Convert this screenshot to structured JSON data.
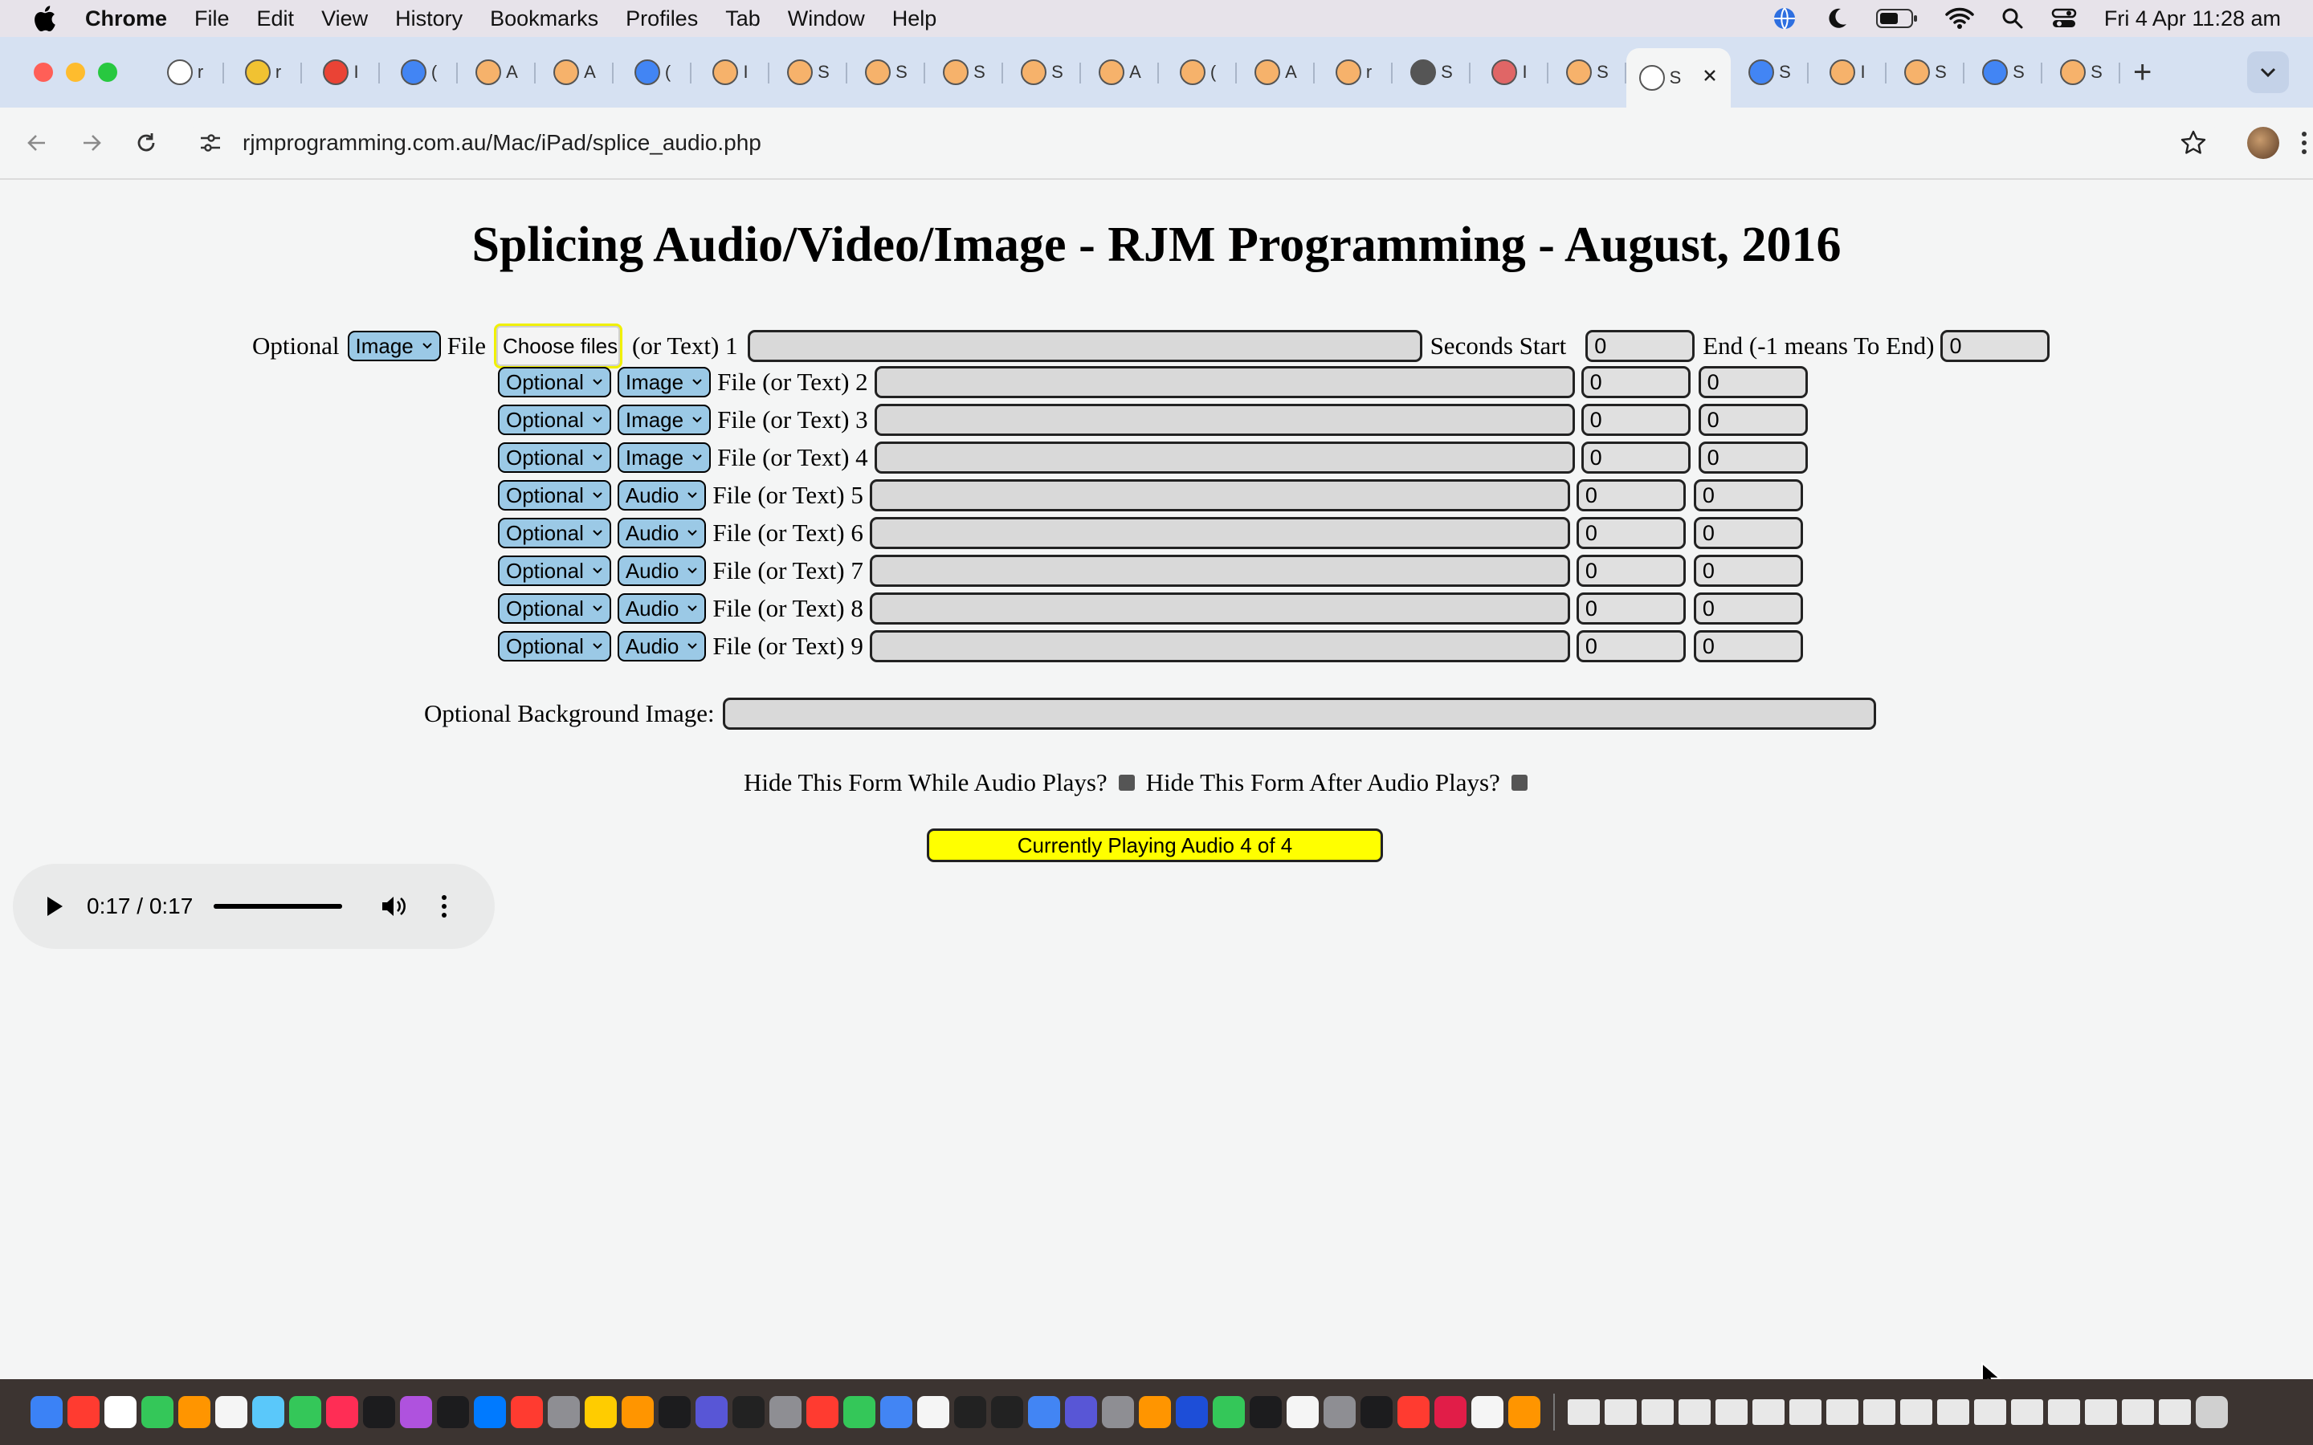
{
  "menubar": {
    "app_name": "Chrome",
    "items": [
      "File",
      "Edit",
      "View",
      "History",
      "Bookmarks",
      "Profiles",
      "Tab",
      "Window",
      "Help"
    ],
    "clock": "Fri 4 Apr  11:28 am",
    "status_icons": [
      "globe-icon",
      "moon-icon",
      "battery-icon",
      "wifi-icon",
      "spotlight-search-icon",
      "control-center-icon"
    ]
  },
  "tabstrip": {
    "tabs": [
      {
        "letter": "r"
      },
      {
        "letter": "r"
      },
      {
        "letter": "I"
      },
      {
        "letter": "("
      },
      {
        "letter": "A"
      },
      {
        "letter": "A"
      },
      {
        "letter": "("
      },
      {
        "letter": "I"
      },
      {
        "letter": "S"
      },
      {
        "letter": "S"
      },
      {
        "letter": "S"
      },
      {
        "letter": "S"
      },
      {
        "letter": "A"
      },
      {
        "letter": "("
      },
      {
        "letter": "A"
      },
      {
        "letter": "r"
      },
      {
        "letter": "S"
      },
      {
        "letter": "I"
      },
      {
        "letter": "S"
      }
    ],
    "active_tab": {
      "letter": "S"
    },
    "tabs_after": [
      {
        "letter": "S"
      },
      {
        "letter": "I"
      },
      {
        "letter": "S"
      },
      {
        "letter": "S"
      },
      {
        "letter": "S"
      }
    ]
  },
  "toolbar": {
    "url": "rjmprogramming.com.au/Mac/iPad/splice_audio.php"
  },
  "page": {
    "title": "Splicing Audio/Video/Image - RJM Programming - August, 2016",
    "row1": {
      "optional_label": "Optional",
      "type": "Image",
      "file_label": "File",
      "choose_files": "Choose files",
      "or_text_label": "(or Text) 1",
      "seconds_start_label": "Seconds Start",
      "start_value": "0",
      "end_label": "End (-1 means To End)",
      "end_value": "0"
    },
    "rows": [
      {
        "optional": "Optional",
        "type": "Image",
        "label": "File (or Text) 2",
        "start": "0",
        "end": "0"
      },
      {
        "optional": "Optional",
        "type": "Image",
        "label": "File (or Text) 3",
        "start": "0",
        "end": "0"
      },
      {
        "optional": "Optional",
        "type": "Image",
        "label": "File (or Text) 4",
        "start": "0",
        "end": "0"
      },
      {
        "optional": "Optional",
        "type": "Audio",
        "label": "File (or Text) 5",
        "start": "0",
        "end": "0"
      },
      {
        "optional": "Optional",
        "type": "Audio",
        "label": "File (or Text) 6",
        "start": "0",
        "end": "0"
      },
      {
        "optional": "Optional",
        "type": "Audio",
        "label": "File (or Text) 7",
        "start": "0",
        "end": "0"
      },
      {
        "optional": "Optional",
        "type": "Audio",
        "label": "File (or Text) 8",
        "start": "0",
        "end": "0"
      },
      {
        "optional": "Optional",
        "type": "Audio",
        "label": "File (or Text) 9",
        "start": "0",
        "end": "0"
      }
    ],
    "background_image_label": "Optional Background Image:",
    "hide_while_label": "Hide This Form While Audio Plays?",
    "hide_after_label": "Hide This Form After Audio Plays?",
    "playing_button": "Currently Playing Audio 4 of 4",
    "audio_player": {
      "time": "0:17 / 0:17",
      "progress_fraction": 1.0
    }
  },
  "colors": {
    "select_bg": "#9bc9e6",
    "playing_button_bg": "#ffff00",
    "choose_files_border": "#f0f000",
    "tabstrip_bg": "#d6e1f2"
  }
}
